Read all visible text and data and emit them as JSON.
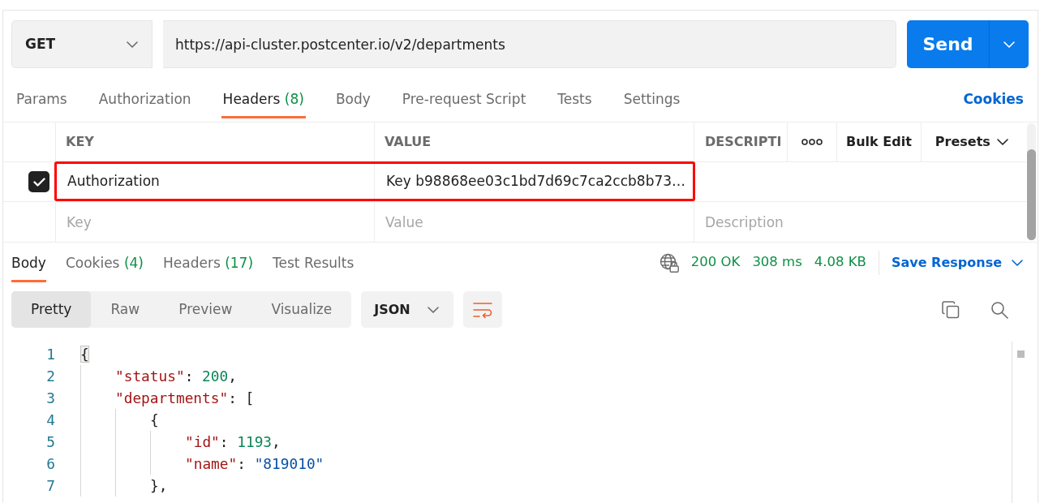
{
  "request": {
    "method": "GET",
    "url": "https://api-cluster.postcenter.io/v2/departments",
    "send_label": "Send"
  },
  "request_tabs": [
    {
      "label": "Params",
      "selected": false
    },
    {
      "label": "Authorization",
      "selected": false
    },
    {
      "label": "Headers",
      "count": "(8)",
      "selected": true
    },
    {
      "label": "Body",
      "selected": false
    },
    {
      "label": "Pre-request Script",
      "selected": false
    },
    {
      "label": "Tests",
      "selected": false
    },
    {
      "label": "Settings",
      "selected": false
    }
  ],
  "cookies_link": "Cookies",
  "headers_table": {
    "columns": [
      "KEY",
      "VALUE",
      "DESCRIPTI"
    ],
    "bulk_edit_label": "Bulk Edit",
    "presets_label": "Presets",
    "rows": [
      {
        "kind": "entry",
        "checked": true,
        "highlighted": true,
        "key": "Authorization",
        "value": "Key b98868ee03c1bd7d69c7ca2ccb8b73…"
      },
      {
        "kind": "blank",
        "highlighted": false,
        "key": {
          "placeholder": "Key"
        },
        "value": {
          "placeholder": "Value"
        },
        "description": {
          "placeholder": "Description"
        }
      }
    ]
  },
  "response": {
    "tabs": [
      {
        "label": "Body",
        "selected": true
      },
      {
        "label": "Cookies",
        "count": "(4)",
        "selected": false
      },
      {
        "label": "Headers",
        "count": "(17)",
        "selected": false
      },
      {
        "label": "Test Results",
        "selected": false
      }
    ],
    "status": "200 OK",
    "time": "308 ms",
    "size": "4.08 KB",
    "save_label": "Save Response",
    "view_modes": [
      {
        "label": "Pretty",
        "selected": true
      },
      {
        "label": "Raw",
        "selected": false
      },
      {
        "label": "Preview",
        "selected": false
      },
      {
        "label": "Visualize",
        "selected": false
      }
    ],
    "format": "JSON",
    "wrap_on": true,
    "code_lines": [
      {
        "number": "1",
        "bracket_highlight": true,
        "tokens": [
          {
            "kind": "punct",
            "text": "{"
          }
        ],
        "children": [
          {
            "number": "2",
            "bracket_highlight": false,
            "tokens": [
              {
                "kind": "key",
                "text": "\"status\""
              },
              {
                "kind": "punct",
                "text": ": "
              },
              {
                "kind": "number",
                "text": "200"
              },
              {
                "kind": "punct",
                "text": ","
              }
            ]
          },
          {
            "number": "3",
            "bracket_highlight": false,
            "tokens": [
              {
                "kind": "key",
                "text": "\"departments\""
              },
              {
                "kind": "punct",
                "text": ": ["
              }
            ],
            "children": [
              {
                "number": "4",
                "bracket_highlight": false,
                "tokens": [
                  {
                    "kind": "punct",
                    "text": "{"
                  }
                ],
                "children": [
                  {
                    "number": "5",
                    "bracket_highlight": false,
                    "tokens": [
                      {
                        "kind": "key",
                        "text": "\"id\""
                      },
                      {
                        "kind": "punct",
                        "text": ": "
                      },
                      {
                        "kind": "number",
                        "text": "1193"
                      },
                      {
                        "kind": "punct",
                        "text": ","
                      }
                    ]
                  },
                  {
                    "number": "6",
                    "bracket_highlight": false,
                    "tokens": [
                      {
                        "kind": "key",
                        "text": "\"name\""
                      },
                      {
                        "kind": "punct",
                        "text": ": "
                      },
                      {
                        "kind": "string",
                        "text": "\"819010\""
                      }
                    ]
                  }
                ]
              },
              {
                "number": "7",
                "bracket_highlight": false,
                "tokens": [
                  {
                    "kind": "punct",
                    "text": "},"
                  }
                ]
              }
            ]
          }
        ]
      }
    ]
  }
}
